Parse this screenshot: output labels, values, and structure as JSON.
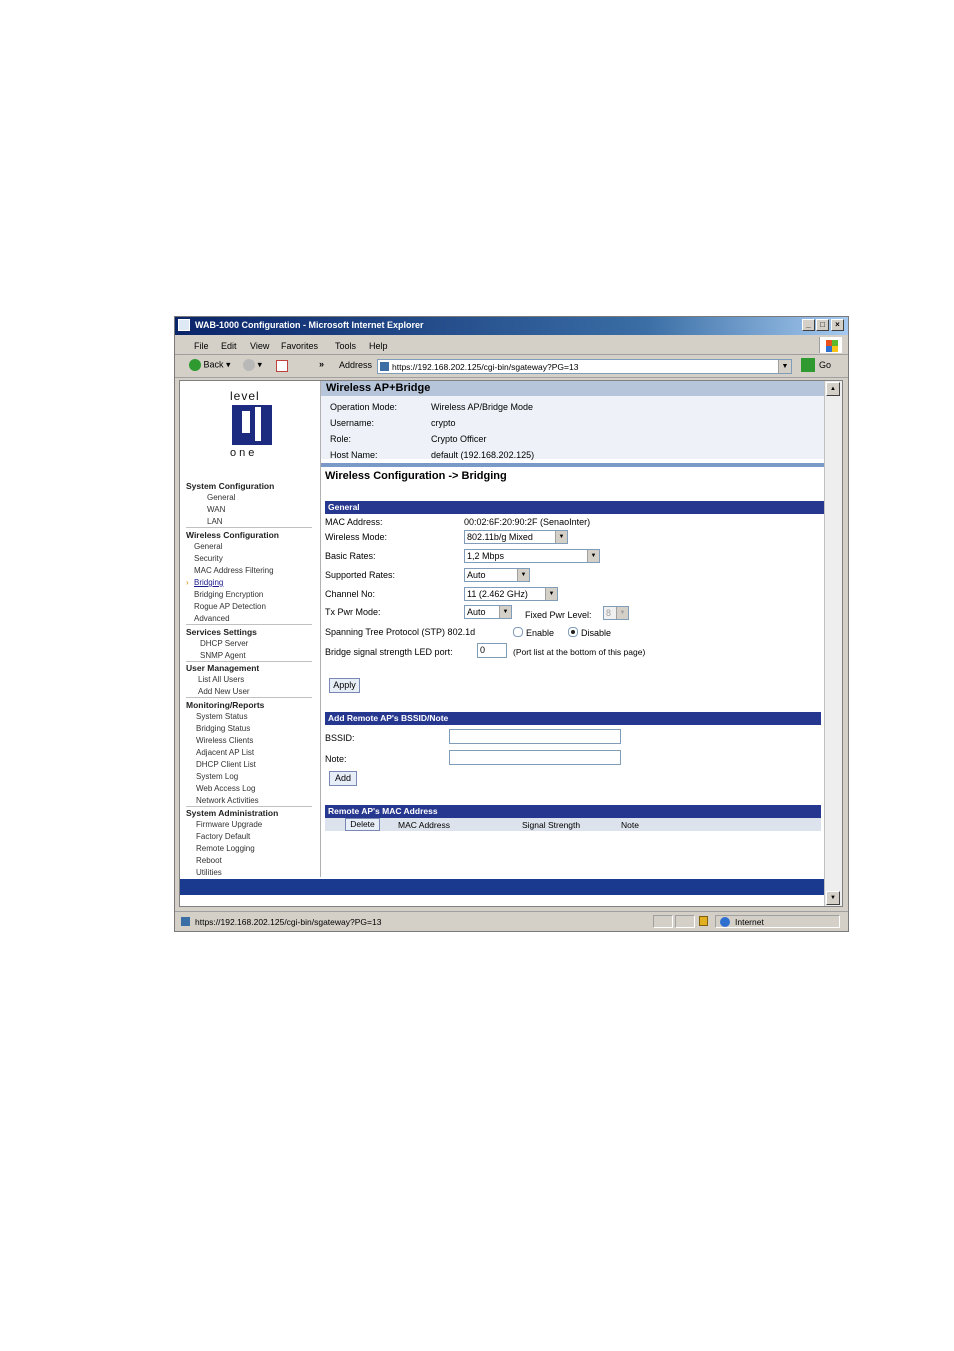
{
  "window": {
    "title": "WAB-1000 Configuration - Microsoft Internet Explorer",
    "min_label": "_",
    "max_label": "□",
    "close_label": "×"
  },
  "menu": {
    "file": "File",
    "edit": "Edit",
    "view": "View",
    "favorites": "Favorites",
    "tools": "Tools",
    "help": "Help"
  },
  "toolbar": {
    "back": "Back",
    "chevrons": "»",
    "address_label": "Address",
    "address": "https://192.168.202.125/cgi-bin/sgateway?PG=13",
    "go": "Go"
  },
  "logo": {
    "top": "level",
    "bottom": "one"
  },
  "sidebar": {
    "sections": [
      {
        "title": "System Configuration",
        "items": [
          "General",
          "WAN",
          "LAN"
        ]
      },
      {
        "title": "Wireless Configuration",
        "items": [
          "General",
          "Security",
          "MAC Address Filtering",
          "Bridging",
          "Bridging Encryption",
          "Rogue AP Detection",
          "Advanced"
        ]
      },
      {
        "title": "Services Settings",
        "items": [
          "DHCP Server",
          "SNMP Agent"
        ]
      },
      {
        "title": "User Management",
        "items": [
          "List All Users",
          "Add New User"
        ]
      },
      {
        "title": "Monitoring/Reports",
        "items": [
          "System Status",
          "Bridging Status",
          "Wireless Clients",
          "Adjacent AP List",
          "DHCP Client List",
          "System Log",
          "Web Access Log",
          "Network Activities"
        ]
      },
      {
        "title": "System Administration",
        "items": [
          "Firmware Upgrade",
          "Factory Default",
          "Remote Logging",
          "Reboot",
          "Utilities"
        ]
      }
    ]
  },
  "header": {
    "title": "Wireless AP+Bridge",
    "rows": [
      {
        "label": "Operation Mode:",
        "value": "Wireless AP/Bridge Mode"
      },
      {
        "label": "Username:",
        "value": "crypto"
      },
      {
        "label": "Role:",
        "value": "Crypto Officer"
      },
      {
        "label": "Host Name:",
        "value": "default (192.168.202.125)"
      }
    ]
  },
  "page_title": "Wireless Configuration -> Bridging",
  "general": {
    "title": "General",
    "mac_label": "MAC Address:",
    "mac_value": "00:02:6F:20:90:2F (SenaoInter)",
    "wireless_mode_label": "Wireless Mode:",
    "wireless_mode": "802.11b/g Mixed",
    "basic_rates_label": "Basic Rates:",
    "basic_rates": "1,2 Mbps",
    "supported_rates_label": "Supported Rates:",
    "supported_rates": "Auto",
    "channel_label": "Channel No:",
    "channel": "11 (2.462 GHz)",
    "txpwr_label": "Tx Pwr Mode:",
    "txpwr": "Auto",
    "fixed_pwr_label": "Fixed Pwr Level:",
    "fixed_pwr": "8",
    "stp_label": "Spanning Tree Protocol (STP) 802.1d",
    "stp_enable": "Enable",
    "stp_disable": "Disable",
    "led_label": "Bridge signal strength LED port:",
    "led_value": "0",
    "led_note": "(Port list at the bottom of this page)",
    "apply": "Apply"
  },
  "remote": {
    "title": "Add Remote AP's BSSID/Note",
    "bssid_label": "BSSID:",
    "note_label": "Note:",
    "add": "Add"
  },
  "mac_list": {
    "title": "Remote AP's MAC Address",
    "delete": "Delete",
    "cols": [
      "MAC Address",
      "Signal Strength",
      "Note"
    ]
  },
  "status": {
    "url": "https://192.168.202.125/cgi-bin/sgateway?PG=13",
    "zone": "Internet"
  }
}
